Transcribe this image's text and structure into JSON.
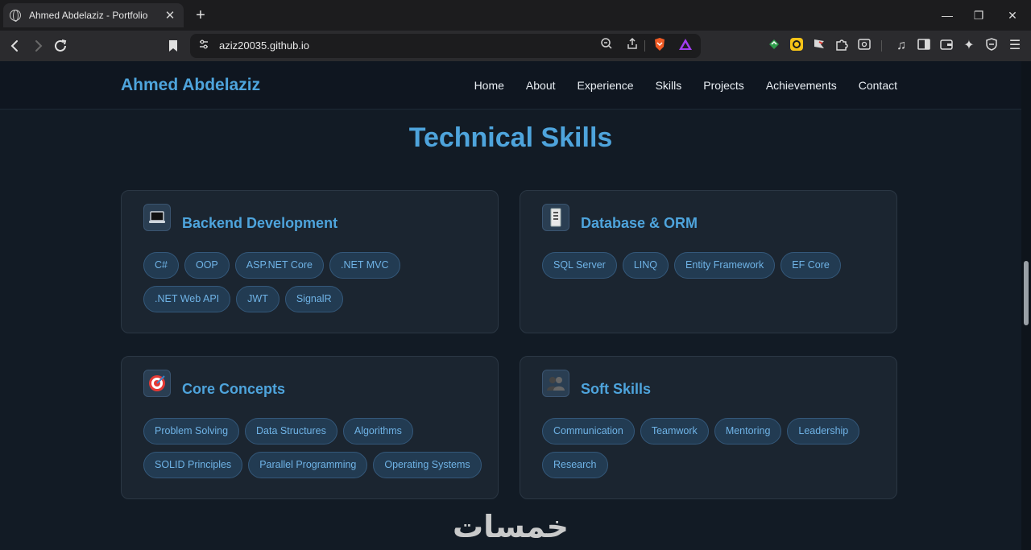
{
  "browser": {
    "tab_title": "Ahmed Abdelaziz - Portfolio",
    "url": "aziz20035.github.io"
  },
  "site": {
    "brand": "Ahmed Abdelaziz",
    "nav": [
      "Home",
      "About",
      "Experience",
      "Skills",
      "Projects",
      "Achievements",
      "Contact"
    ]
  },
  "skills": {
    "title": "Technical Skills",
    "cards": [
      {
        "icon": "laptop-icon",
        "title": "Backend Development",
        "tags": [
          "C#",
          "OOP",
          "ASP.NET Core",
          ".NET MVC",
          ".NET Web API",
          "JWT",
          "SignalR"
        ]
      },
      {
        "icon": "database-icon",
        "title": "Database & ORM",
        "tags": [
          "SQL Server",
          "LINQ",
          "Entity Framework",
          "EF Core"
        ]
      },
      {
        "icon": "target-icon",
        "title": "Core Concepts",
        "tags": [
          "Problem Solving",
          "Data Structures",
          "Algorithms",
          "SOLID Principles",
          "Parallel Programming",
          "Operating Systems"
        ]
      },
      {
        "icon": "people-icon",
        "title": "Soft Skills",
        "tags": [
          "Communication",
          "Teamwork",
          "Mentoring",
          "Leadership",
          "Research"
        ]
      }
    ]
  },
  "watermark": "خمسات"
}
